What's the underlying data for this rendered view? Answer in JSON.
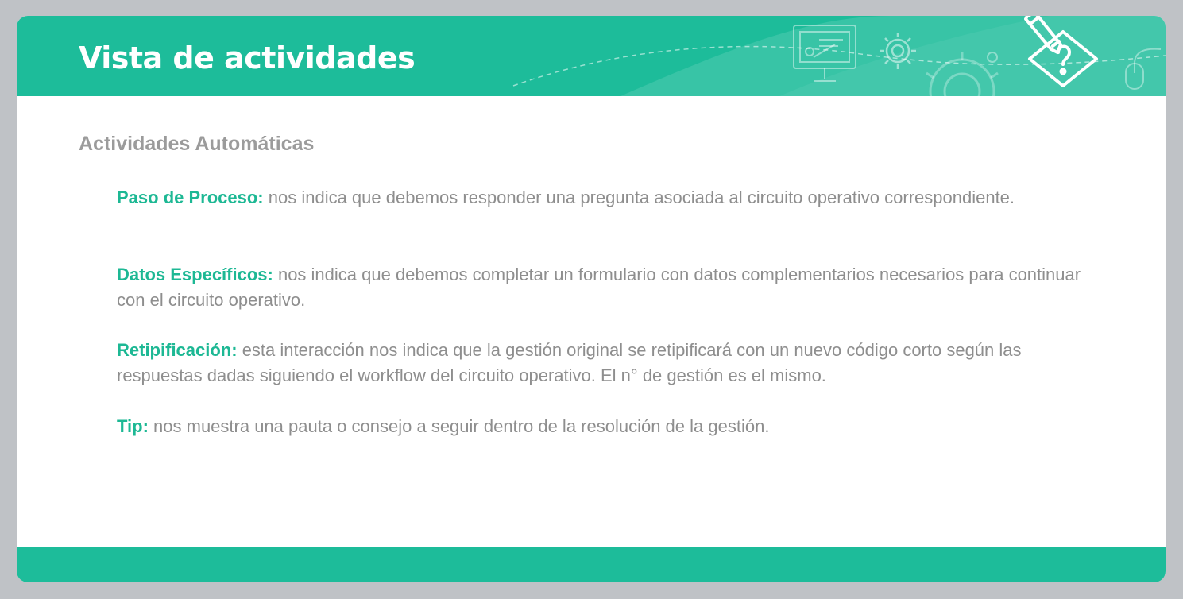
{
  "header": {
    "title": "Vista de actividades"
  },
  "section": {
    "title": "Actividades Automáticas",
    "items": [
      {
        "term": "Paso de Proceso:",
        "text": " nos indica que debemos responder una pregunta asociada al circuito operativo correspondiente."
      },
      {
        "term": "Datos Específicos:",
        "text": " nos indica que debemos completar un formulario con datos complementarios necesarios para continuar con el circuito operativo."
      },
      {
        "term": "Retipificación:",
        "text": " esta interacción nos indica que la gestión original se retipificará con un nuevo código corto según las respuestas dadas siguiendo el workflow del circuito operativo. El n° de gestión es el mismo."
      },
      {
        "term": "Tip:",
        "text": " nos muestra una pauta o consejo a seguir dentro de la resolución de la gestión."
      }
    ]
  },
  "colors": {
    "accent": "#1dbc9a",
    "term": "#1db894",
    "text": "#8e8e8e",
    "section_title": "#9b9b9b",
    "frame": "#bfc2c6"
  },
  "icons": [
    "monitor-icon",
    "gear-icon",
    "mouse-icon",
    "edit-help-icon"
  ]
}
